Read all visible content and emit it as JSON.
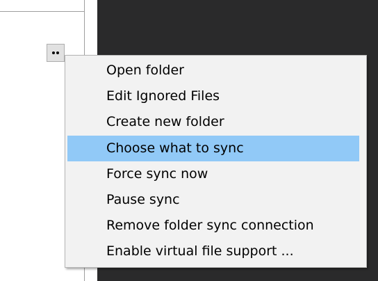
{
  "colors": {
    "dark_background": "#2a2a2b",
    "menu_background": "#f2f2f2",
    "highlight": "#91c9f7"
  },
  "more_button": {
    "icon": "more-dots-icon"
  },
  "context_menu": {
    "items": [
      {
        "label": "Open folder"
      },
      {
        "label": "Edit Ignored Files"
      },
      {
        "label": "Create new folder"
      },
      {
        "label": "Choose what to sync",
        "highlighted": true
      },
      {
        "label": "Force sync now"
      },
      {
        "label": "Pause sync"
      },
      {
        "label": "Remove folder sync connection"
      },
      {
        "label": "Enable virtual file support ..."
      }
    ]
  }
}
